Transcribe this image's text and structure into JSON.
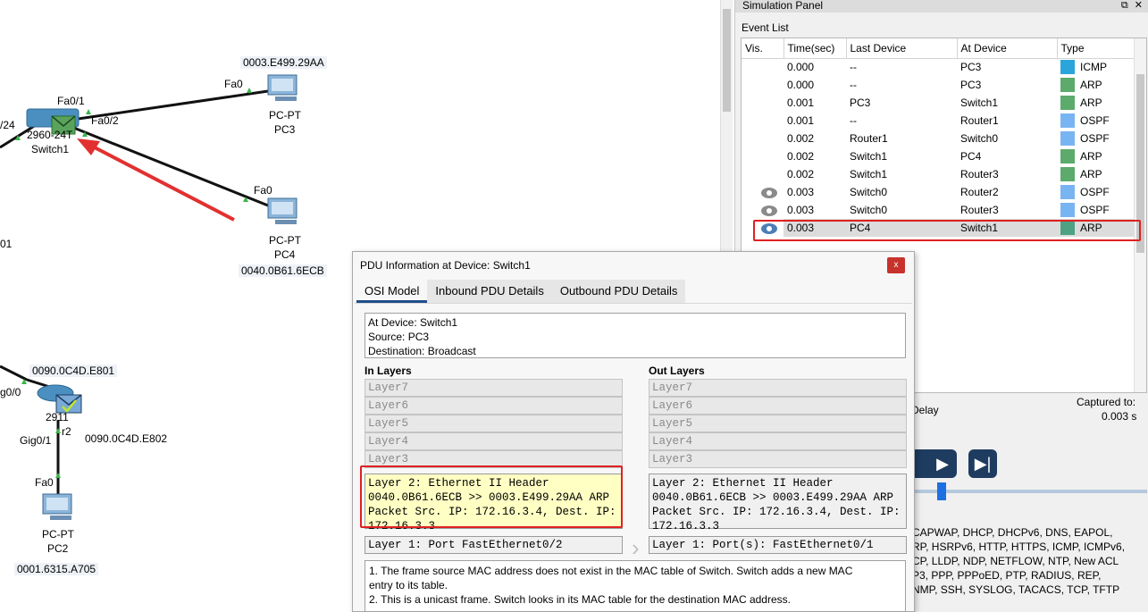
{
  "topology": {
    "switch1": {
      "model_label": "2960-24T",
      "name": "Switch1"
    },
    "pc3": {
      "mac": "0003.E499.29AA",
      "type": "PC-PT",
      "name": "PC3",
      "port": "Fa0"
    },
    "pc4": {
      "mac": "0040.0B61.6ECB",
      "type": "PC-PT",
      "name": "PC4",
      "port": "Fa0"
    },
    "router2": {
      "model_label": "2911",
      "name_partial": "r2",
      "mac_top": "0090.0C4D.E801",
      "mac_bottom": "0090.0C4D.E802",
      "port_left": "g0/0",
      "port_bottom": "Gig0/1"
    },
    "pc2": {
      "mac": "0001.6315.A705",
      "type": "PC-PT",
      "name": "PC2",
      "port": "Fa0"
    },
    "switch_ports": {
      "fa01": "Fa0/1",
      "fa02": "Fa0/2",
      "left_partial": "/24"
    },
    "left_edge_text": "01"
  },
  "sim_panel": {
    "title": "Simulation Panel",
    "event_list_label": "Event List",
    "columns": [
      "Vis.",
      "Time(sec)",
      "Last Device",
      "At Device",
      "Type"
    ],
    "events": [
      {
        "vis": "",
        "time": "0.000",
        "last": "--",
        "at": "PC3",
        "type": "ICMP",
        "color": "#2aa5dc"
      },
      {
        "vis": "",
        "time": "0.000",
        "last": "--",
        "at": "PC3",
        "type": "ARP",
        "color": "#5cab6c"
      },
      {
        "vis": "",
        "time": "0.001",
        "last": "PC3",
        "at": "Switch1",
        "type": "ARP",
        "color": "#5cab6c"
      },
      {
        "vis": "",
        "time": "0.001",
        "last": "--",
        "at": "Router1",
        "type": "OSPF",
        "color": "#79b4f2"
      },
      {
        "vis": "",
        "time": "0.002",
        "last": "Router1",
        "at": "Switch0",
        "type": "OSPF",
        "color": "#79b4f2"
      },
      {
        "vis": "",
        "time": "0.002",
        "last": "Switch1",
        "at": "PC4",
        "type": "ARP",
        "color": "#5cab6c"
      },
      {
        "vis": "",
        "time": "0.002",
        "last": "Switch1",
        "at": "Router3",
        "type": "ARP",
        "color": "#5cab6c"
      },
      {
        "vis": "eye",
        "time": "0.003",
        "last": "Switch0",
        "at": "Router2",
        "type": "OSPF",
        "color": "#79b4f2"
      },
      {
        "vis": "eye",
        "time": "0.003",
        "last": "Switch0",
        "at": "Router3",
        "type": "OSPF",
        "color": "#79b4f2"
      },
      {
        "vis": "eye-blue",
        "time": "0.003",
        "last": "PC4",
        "at": "Switch1",
        "type": "ARP",
        "color": "#4fa183"
      }
    ],
    "delay_label": "Delay",
    "captured_label": "Captured to:",
    "captured_value": "0.003 s",
    "filter_lines": [
      "CAPWAP, DHCP, DHCPv6, DNS, EAPOL,",
      "RP, HSRPv6, HTTP, HTTPS, ICMP, ICMPv6,",
      "CP, LLDP, NDP, NETFLOW, NTP, New ACL",
      "P3, PPP, PPPoED, PTP, RADIUS, REP,",
      "NMP, SSH, SYSLOG, TACACS, TCP, TFTP"
    ],
    "buttons": {
      "play": "▶",
      "step": "▶|"
    }
  },
  "pdu": {
    "title": "PDU Information at Device: Switch1",
    "close": "x",
    "tabs": [
      "OSI Model",
      "Inbound PDU Details",
      "Outbound PDU Details"
    ],
    "info": [
      "At Device: Switch1",
      "Source: PC3",
      "Destination: Broadcast"
    ],
    "in_heading": "In Layers",
    "out_heading": "Out Layers",
    "in_layers": [
      "Layer7",
      "Layer6",
      "Layer5",
      "Layer4",
      "Layer3"
    ],
    "out_layers": [
      "Layer7",
      "Layer6",
      "Layer5",
      "Layer4",
      "Layer3"
    ],
    "in_l2": [
      "Layer 2: Ethernet II Header",
      "0040.0B61.6ECB >> 0003.E499.29AA ARP",
      "Packet Src. IP: 172.16.3.4, Dest. IP:",
      "172.16.3.3"
    ],
    "out_l2": [
      "Layer 2: Ethernet II Header",
      "0040.0B61.6ECB >> 0003.E499.29AA ARP",
      "Packet Src. IP: 172.16.3.4, Dest. IP:",
      "172.16.3.3"
    ],
    "in_l1": "Layer 1: Port FastEthernet0/2",
    "out_l1": "Layer 1: Port(s): FastEthernet0/1",
    "description": [
      "1. The frame source MAC address does not exist in the MAC table of Switch. Switch adds a new MAC",
      "entry to its table.",
      "2. This is a unicast frame. Switch looks in its MAC table for the destination MAC address."
    ]
  }
}
